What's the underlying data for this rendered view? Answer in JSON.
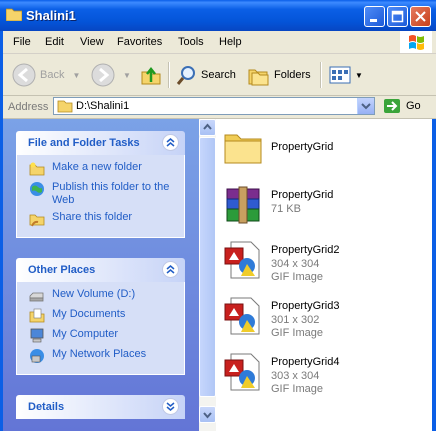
{
  "window": {
    "title": "Shalini1"
  },
  "menu": [
    "File",
    "Edit",
    "View",
    "Favorites",
    "Tools",
    "Help"
  ],
  "toolbar": {
    "back": "Back",
    "search": "Search",
    "folders": "Folders"
  },
  "address": {
    "label": "Address",
    "value": "D:\\Shalini1",
    "go": "Go"
  },
  "tasks_panel": {
    "title": "File and Folder Tasks",
    "items": [
      "Make a new folder",
      "Publish this folder to the Web",
      "Share this folder"
    ]
  },
  "places_panel": {
    "title": "Other Places",
    "items": [
      "New Volume (D:)",
      "My Documents",
      "My Computer",
      "My Network Places"
    ]
  },
  "details_panel": {
    "title": "Details"
  },
  "files": [
    {
      "name": "PropertyGrid",
      "line2": "",
      "line3": "",
      "type": "folder"
    },
    {
      "name": "PropertyGrid",
      "line2": "71 KB",
      "line3": "",
      "type": "rar"
    },
    {
      "name": "PropertyGrid2",
      "line2": "304 x 304",
      "line3": "GIF Image",
      "type": "gif"
    },
    {
      "name": "PropertyGrid3",
      "line2": "301 x 302",
      "line3": "GIF Image",
      "type": "gif"
    },
    {
      "name": "PropertyGrid4",
      "line2": "303 x 304",
      "line3": "GIF Image",
      "type": "gif"
    }
  ]
}
